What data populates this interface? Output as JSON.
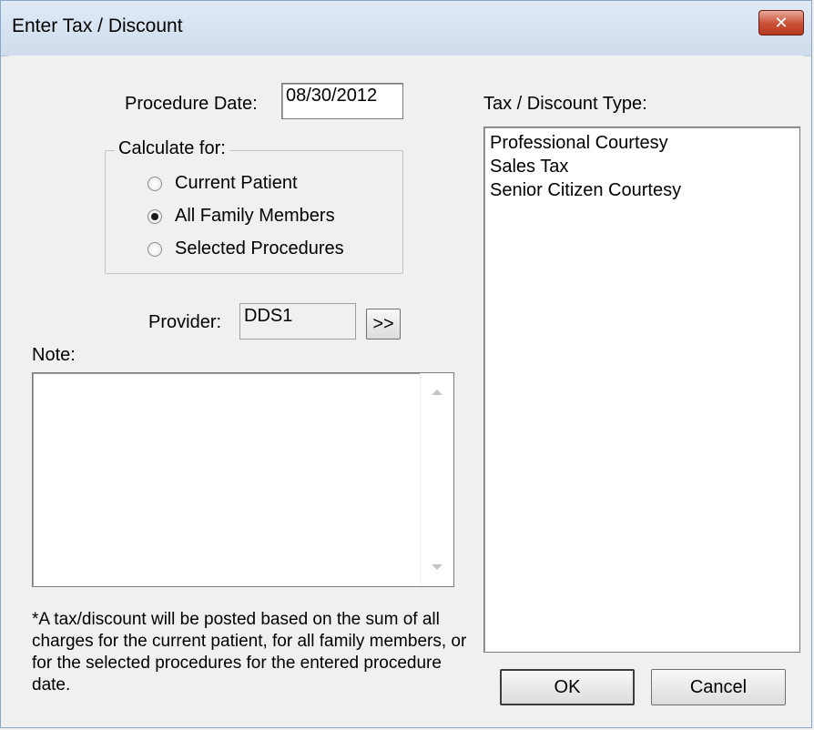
{
  "window": {
    "title": "Enter Tax / Discount",
    "close_label": "✕"
  },
  "procedure_date": {
    "label": "Procedure Date:",
    "value": "08/30/2012"
  },
  "calculate_for": {
    "legend": "Calculate for:",
    "options": [
      {
        "label": "Current Patient",
        "checked": false
      },
      {
        "label": "All Family Members",
        "checked": true
      },
      {
        "label": "Selected Procedures",
        "checked": false
      }
    ]
  },
  "provider": {
    "label": "Provider:",
    "value": "DDS1",
    "browse_label": ">>"
  },
  "note": {
    "label": "Note:",
    "value": ""
  },
  "footnote": "*A tax/discount will be posted based on the sum of all charges for the current patient, for all family members, or for the selected procedures for the entered procedure date.",
  "tax_discount_type": {
    "label": "Tax / Discount Type:",
    "items": [
      "Professional Courtesy",
      "Sales Tax",
      "Senior Citizen Courtesy"
    ]
  },
  "buttons": {
    "ok": "OK",
    "cancel": "Cancel"
  }
}
